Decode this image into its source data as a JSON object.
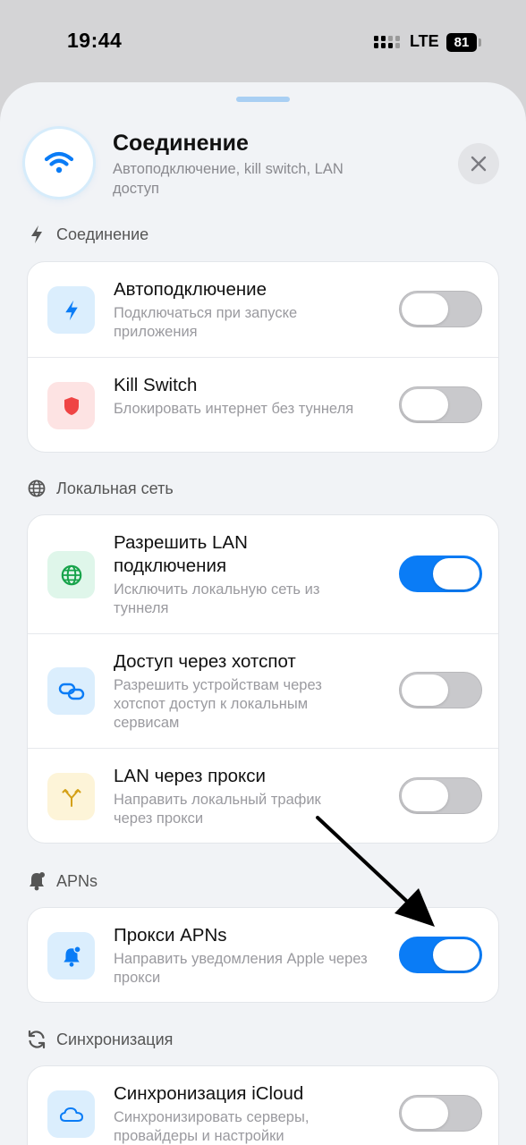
{
  "status_bar": {
    "time": "19:44",
    "network": "LTE",
    "battery": "81"
  },
  "header": {
    "title": "Соединение",
    "subtitle": "Автоподключение, kill switch, LAN доступ",
    "icon": "wifi-icon",
    "close_icon": "close-icon"
  },
  "sections": {
    "connection": {
      "label": "Соединение",
      "icon": "bolt-icon",
      "rows": [
        {
          "title": "Автоподключение",
          "desc": "Подключаться при запуске приложения",
          "icon": "bolt-icon",
          "on": false
        },
        {
          "title": "Kill Switch",
          "desc": "Блокировать интернет без туннеля",
          "icon": "shield-icon",
          "on": false
        }
      ]
    },
    "lan": {
      "label": "Локальная сеть",
      "icon": "globe-icon",
      "rows": [
        {
          "title": "Разрешить LAN подключения",
          "desc": "Исключить локальную сеть из туннеля",
          "icon": "globe-icon",
          "on": true
        },
        {
          "title": "Доступ через хотспот",
          "desc": "Разрешить устройствам через хотспот доступ к локальным сервисам",
          "icon": "link-icon",
          "on": false
        },
        {
          "title": "LAN через прокси",
          "desc": "Направить локальный трафик через прокси",
          "icon": "fork-icon",
          "on": false
        }
      ]
    },
    "apns": {
      "label": "APNs",
      "icon": "bell-icon",
      "rows": [
        {
          "title": "Прокси APNs",
          "desc": "Направить уведомления Apple через прокси",
          "icon": "bell-badge-icon",
          "on": true
        }
      ]
    },
    "sync": {
      "label": "Синхронизация",
      "icon": "sync-icon",
      "rows": [
        {
          "title": "Синхронизация iCloud",
          "desc": "Синхронизировать серверы, провайдеры и настройки",
          "icon": "cloud-icon",
          "on": false
        }
      ]
    }
  },
  "colors": {
    "accent": "#0a7cf6",
    "toggle_off": "#c9c9cc",
    "annotation_arrow": "#000000"
  }
}
